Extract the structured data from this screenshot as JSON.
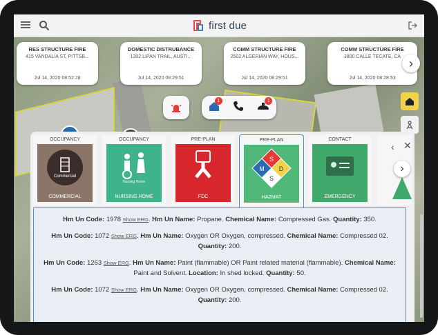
{
  "app": {
    "name": "first due"
  },
  "incidents": [
    {
      "type": "RES STRUCTURE FIRE",
      "address": "415 VANDALIA ST, PITTSB...",
      "time": "Jul 14, 2020 08:52:28"
    },
    {
      "type": "DOMESTIC DISTRUBANCE",
      "address": "1302 LIPAN TRAIL, AUSTI...",
      "time": "Jul 14, 2020 08:29:51"
    },
    {
      "type": "COMM STRUCTURE FIRE",
      "address": "2502 ALGERIAN WAY, HOUS...",
      "time": "Jul 14, 2020 08:29:51"
    },
    {
      "type": "COMM STRUCTURE FIRE",
      "address": "3800 CALLE TECATE, CA",
      "time": "Jul 14, 2020 08:28:53"
    }
  ],
  "action_badges": {
    "home": "1",
    "phone": "",
    "units": "1"
  },
  "tiles": [
    {
      "header": "OCCUPANCY",
      "label": "COMMERCIAL",
      "inner": "Commercial",
      "color": "#8a7568"
    },
    {
      "header": "OCCUPANCY",
      "label": "NURSING HOME",
      "inner": "Nursing Home",
      "color": "#3fb48a"
    },
    {
      "header": "PRE-PLAN",
      "label": "FDC",
      "inner": "",
      "color": "#d8262d"
    },
    {
      "header": "PRE-PLAN",
      "label": "HAZMAT",
      "inner": "",
      "color": "#50b97a"
    },
    {
      "header": "CONTACT",
      "label": "EMERGENCY",
      "inner": "",
      "color": "#3fa86a"
    }
  ],
  "hazmat_symbol": {
    "top": "S",
    "left": "M",
    "right": "D",
    "bottom": "S"
  },
  "hazmat_records": [
    {
      "un_code": "1978",
      "un_name": "Propane.",
      "chemical_name": "Compressed Gas.",
      "location": "",
      "quantity": "350."
    },
    {
      "un_code": "1072",
      "un_name": "Oxygen OR Oxygen, compressed.",
      "chemical_name": "Compressed 02.",
      "location": "",
      "quantity": "200."
    },
    {
      "un_code": "1263",
      "un_name": "Paint (flammable) OR Paint related material (flammable).",
      "chemical_name": "Paint and Solvent.",
      "location": "In shed locked.",
      "quantity": "50."
    },
    {
      "un_code": "1072",
      "un_name": "Oxygen OR Oxygen, compressed.",
      "chemical_name": "Compressed 02.",
      "location": "",
      "quantity": "200."
    }
  ],
  "labels": {
    "hm_un_code": "Hm Un Code:",
    "show_erg": "Show ERG",
    "hm_un_name": "Hm Un Name:",
    "chemical_name": "Chemical Name:",
    "location": "Location:",
    "quantity": "Quantity:"
  },
  "colors": {
    "accent": "#4a90d9",
    "home_button": "#f2d24a",
    "badge": "#e53935"
  },
  "icons": [
    "menu-icon",
    "search-icon",
    "logo-icon",
    "logout-icon",
    "chevron-right-icon",
    "alarm-icon",
    "home-icon",
    "phone-icon",
    "units-icon",
    "home-icon",
    "tower-icon",
    "chevron-left-icon",
    "close-icon"
  ]
}
